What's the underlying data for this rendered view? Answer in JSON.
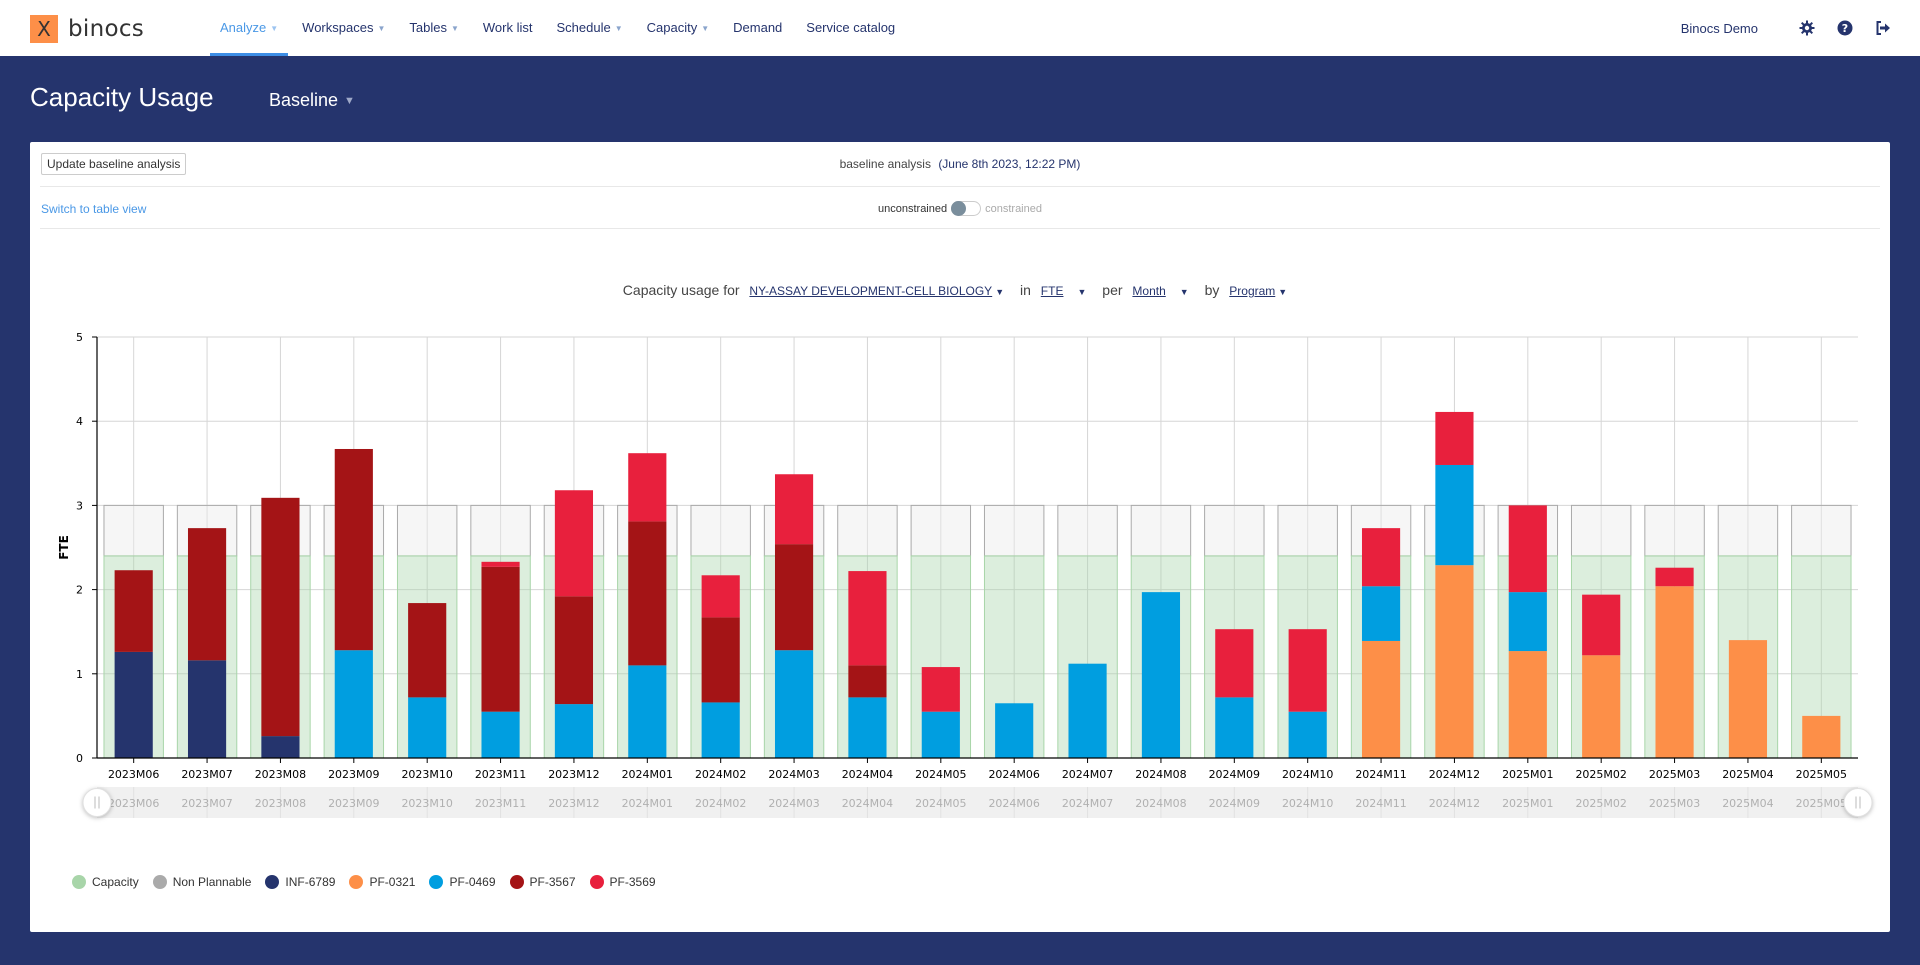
{
  "app": {
    "logo_glyph": "X",
    "brand": "binocs",
    "user_name": "Binocs Demo"
  },
  "nav": {
    "items": [
      {
        "label": "Analyze",
        "has_dropdown": true,
        "active": true
      },
      {
        "label": "Workspaces",
        "has_dropdown": true,
        "active": false
      },
      {
        "label": "Tables",
        "has_dropdown": true,
        "active": false
      },
      {
        "label": "Work list",
        "has_dropdown": false,
        "active": false
      },
      {
        "label": "Schedule",
        "has_dropdown": true,
        "active": false
      },
      {
        "label": "Capacity",
        "has_dropdown": true,
        "active": false
      },
      {
        "label": "Demand",
        "has_dropdown": false,
        "active": false
      },
      {
        "label": "Service catalog",
        "has_dropdown": false,
        "active": false
      }
    ],
    "right_icons": [
      "gear-icon",
      "help-icon",
      "logout-icon"
    ]
  },
  "page": {
    "title": "Capacity Usage",
    "scenario": "Baseline"
  },
  "toolbar": {
    "update_button": "Update baseline analysis",
    "analysis_label": "baseline analysis",
    "analysis_date": "(June 8th 2023, 12:22 PM)",
    "table_link": "Switch to table view",
    "toggle_left": "unconstrained",
    "toggle_right": "constrained",
    "toggle_state": "unconstrained"
  },
  "chart_header": {
    "prefix": "Capacity usage for",
    "resource": "NY-ASSAY DEVELOPMENT-CELL BIOLOGY",
    "in_word": "in",
    "unit": "FTE",
    "per_word": "per",
    "period": "Month",
    "by_word": "by",
    "group": "Program"
  },
  "colors": {
    "accent": "#4a98e6",
    "navy": "#25346d",
    "Capacity": "#a8d5a9",
    "Non Plannable": "#aaaaaa",
    "INF-6789": "#25346d",
    "PF-0321": "#fd8f48",
    "PF-0469": "#009ee0",
    "PF-3567": "#a41416",
    "PF-3569": "#e8203d"
  },
  "chart_data": {
    "type": "bar",
    "stacked": true,
    "title": "",
    "xlabel": "",
    "ylabel": "FTE",
    "ylim": [
      0,
      5
    ],
    "yticks": [
      0,
      1,
      2,
      3,
      4,
      5
    ],
    "grid": true,
    "legend_position": "bottom-left",
    "categories": [
      "2023M06",
      "2023M07",
      "2023M08",
      "2023M09",
      "2023M10",
      "2023M11",
      "2023M12",
      "2024M01",
      "2024M02",
      "2024M03",
      "2024M04",
      "2024M05",
      "2024M06",
      "2024M07",
      "2024M08",
      "2024M09",
      "2024M10",
      "2024M11",
      "2024M12",
      "2025M01",
      "2025M02",
      "2025M03",
      "2025M04",
      "2025M05"
    ],
    "capacity": {
      "name": "Capacity",
      "values": [
        2.4,
        2.4,
        2.4,
        2.4,
        2.4,
        2.4,
        2.4,
        2.4,
        2.4,
        2.4,
        2.4,
        2.4,
        2.4,
        2.4,
        2.4,
        2.4,
        2.4,
        2.4,
        2.4,
        2.4,
        2.4,
        2.4,
        2.4,
        2.4
      ]
    },
    "non_plannable": {
      "name": "Non Plannable",
      "values": [
        0.6,
        0.6,
        0.6,
        0.6,
        0.6,
        0.6,
        0.6,
        0.6,
        0.6,
        0.6,
        0.6,
        0.6,
        0.6,
        0.6,
        0.6,
        0.6,
        0.6,
        0.6,
        0.6,
        0.6,
        0.6,
        0.6,
        0.6,
        0.6
      ]
    },
    "series": [
      {
        "name": "INF-6789",
        "values": [
          1.26,
          1.16,
          0.26,
          0,
          0,
          0,
          0,
          0,
          0,
          0,
          0,
          0,
          0,
          0,
          0,
          0,
          0,
          0,
          0,
          0,
          0,
          0,
          0,
          0
        ]
      },
      {
        "name": "PF-0321",
        "values": [
          0,
          0,
          0,
          0,
          0,
          0,
          0,
          0,
          0,
          0,
          0,
          0,
          0,
          0,
          0,
          0,
          0,
          1.39,
          2.29,
          1.27,
          1.22,
          2.04,
          1.4,
          0.5
        ]
      },
      {
        "name": "PF-0469",
        "values": [
          0,
          0,
          0,
          1.28,
          0.72,
          0.55,
          0.64,
          1.1,
          0.66,
          1.28,
          0.72,
          0.55,
          0.65,
          1.12,
          1.97,
          0.72,
          0.55,
          0.65,
          1.19,
          0.7,
          0,
          0,
          0,
          0
        ]
      },
      {
        "name": "PF-3567",
        "values": [
          0.97,
          1.57,
          2.83,
          2.39,
          1.12,
          1.72,
          1.28,
          1.71,
          1.01,
          1.26,
          0.38,
          0,
          0,
          0,
          0,
          0,
          0,
          0,
          0,
          0,
          0,
          0,
          0,
          0
        ]
      },
      {
        "name": "PF-3569",
        "values": [
          0,
          0,
          0,
          0,
          0,
          0.06,
          1.26,
          0.81,
          0.5,
          0.83,
          1.12,
          0.53,
          0,
          0,
          0,
          0.81,
          0.98,
          0.69,
          0.63,
          1.03,
          0.72,
          0.22,
          0,
          0
        ]
      }
    ],
    "legend": [
      "Capacity",
      "Non Plannable",
      "INF-6789",
      "PF-0321",
      "PF-0469",
      "PF-3567",
      "PF-3569"
    ]
  }
}
